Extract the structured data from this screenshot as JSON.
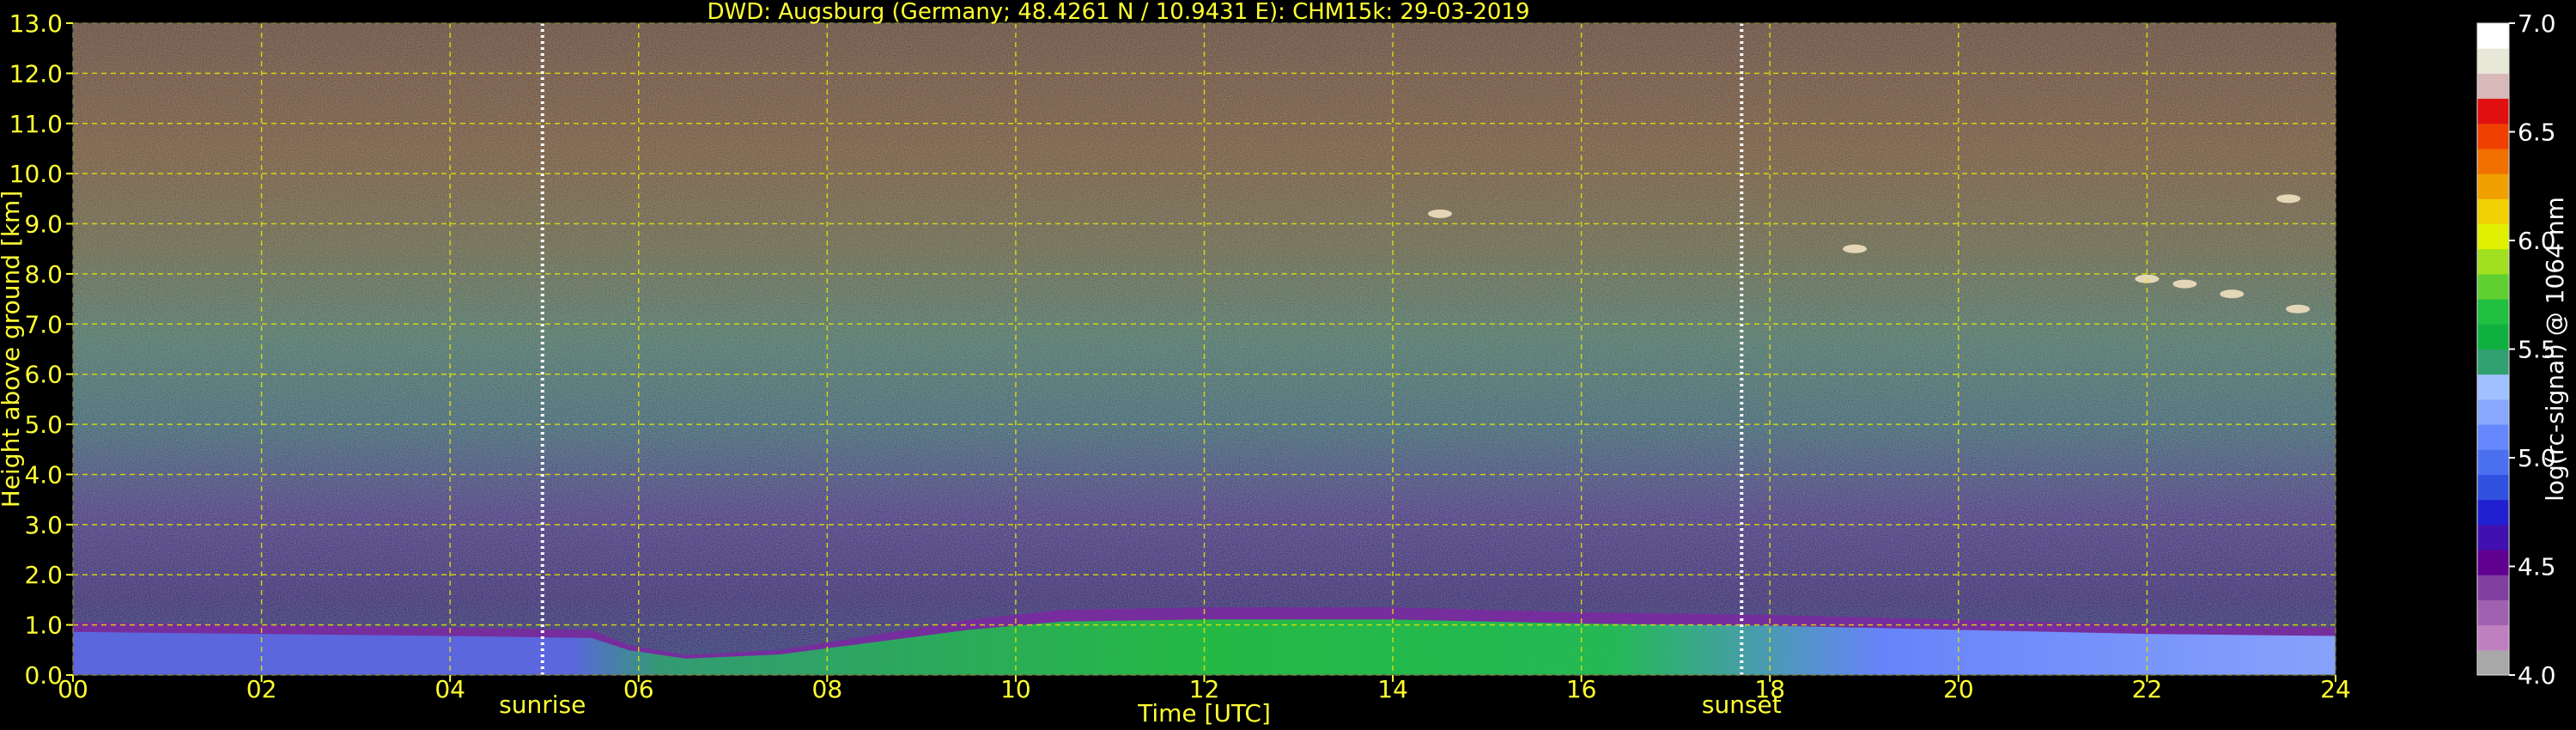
{
  "chart_data": {
    "type": "heatmap",
    "title": "DWD: Augsburg (Germany; 48.4261 N / 10.9431 E):    CHM15k: 29-03-2019",
    "xlabel": "Time [UTC]",
    "ylabel": "Height above ground [km]",
    "xlim": [
      0,
      24
    ],
    "ylim": [
      0,
      13
    ],
    "x_ticks": [
      "00",
      "02",
      "04",
      "06",
      "08",
      "10",
      "12",
      "14",
      "16",
      "18",
      "20",
      "22",
      "24"
    ],
    "y_ticks": [
      "0.0",
      "1.0",
      "2.0",
      "3.0",
      "4.0",
      "5.0",
      "6.0",
      "7.0",
      "8.0",
      "9.0",
      "10.0",
      "11.0",
      "12.0",
      "13.0"
    ],
    "grid": true,
    "annotations": [
      {
        "text": "sunrise",
        "x": 4.98
      },
      {
        "text": "sunset",
        "x": 17.7
      }
    ],
    "colorbar": {
      "label": "log(rc-signal) @ 1064 nm",
      "range": [
        4.0,
        7.0
      ],
      "ticks": [
        "4.0",
        "4.5",
        "5.0",
        "5.5",
        "6.0",
        "6.5",
        "7.0"
      ],
      "colors": [
        "#a8a8a8",
        "#c080c0",
        "#a060b0",
        "#8040a0",
        "#600090",
        "#4010b0",
        "#2020d0",
        "#3050e0",
        "#4a70f0",
        "#6688ff",
        "#88a8ff",
        "#a0c0ff",
        "#30a070",
        "#10b040",
        "#20c040",
        "#60d030",
        "#a0e020",
        "#e0f000",
        "#f0d000",
        "#f0a000",
        "#f07000",
        "#f04000",
        "#e01010",
        "#d8b8b8",
        "#e8e8d8",
        "#ffffff"
      ]
    },
    "layers": [
      {
        "name": "boundary-layer",
        "x": [
          0,
          2,
          4,
          5.5,
          5.9,
          6.5,
          7.5,
          8.5,
          9.5,
          10.5,
          12,
          14,
          16,
          18,
          20,
          22,
          24
        ],
        "top_km": [
          1.05,
          1.0,
          0.95,
          0.9,
          0.6,
          0.4,
          0.5,
          0.8,
          1.1,
          1.3,
          1.35,
          1.35,
          1.25,
          1.2,
          1.1,
          1.0,
          0.95
        ]
      },
      {
        "name": "cloud-patches",
        "points": [
          [
            14.5,
            9.2
          ],
          [
            18.9,
            8.5
          ],
          [
            22.0,
            7.9
          ],
          [
            22.4,
            7.8
          ],
          [
            22.9,
            7.6
          ],
          [
            23.6,
            7.3
          ],
          [
            23.5,
            9.5
          ]
        ]
      }
    ]
  }
}
